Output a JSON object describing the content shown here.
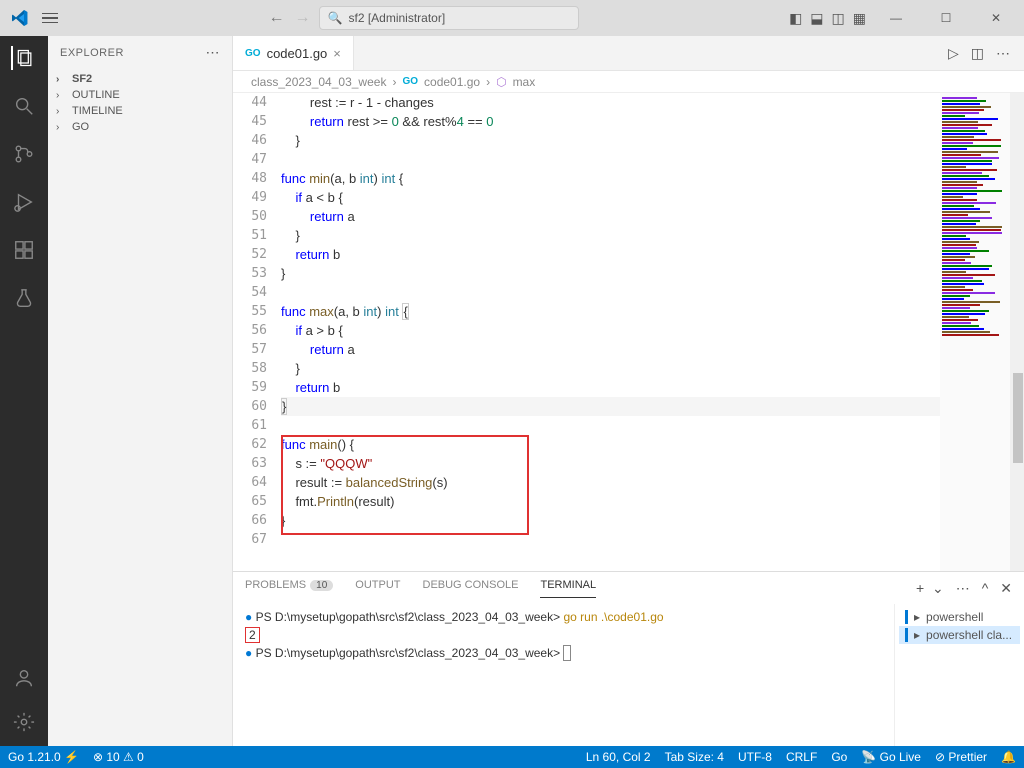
{
  "title_search": "sf2 [Administrator]",
  "explorer": {
    "title": "EXPLORER",
    "items": [
      "SF2",
      "OUTLINE",
      "TIMELINE",
      "GO"
    ]
  },
  "tab": {
    "filename": "code01.go",
    "close": "×"
  },
  "breadcrumb": {
    "folder": "class_2023_04_03_week",
    "file": "code01.go",
    "symbol": "max"
  },
  "code_lines": [
    {
      "n": "44",
      "html": "        rest := r - 1 - changes"
    },
    {
      "n": "45",
      "html": "        <span class='kw'>return</span> rest >= <span class='num'>0</span> && rest%<span class='num'>4</span> == <span class='num'>0</span>"
    },
    {
      "n": "46",
      "html": "    }"
    },
    {
      "n": "47",
      "html": ""
    },
    {
      "n": "48",
      "html": "<span class='kw'>func</span> <span class='fn'>min</span>(a, b <span class='typ'>int</span>) <span class='typ'>int</span> {"
    },
    {
      "n": "49",
      "html": "    <span class='kw'>if</span> a < b {"
    },
    {
      "n": "50",
      "html": "        <span class='kw'>return</span> a"
    },
    {
      "n": "51",
      "html": "    }"
    },
    {
      "n": "52",
      "html": "    <span class='kw'>return</span> b"
    },
    {
      "n": "53",
      "html": "}"
    },
    {
      "n": "54",
      "html": ""
    },
    {
      "n": "55",
      "html": "<span class='kw'>func</span> <span class='fn'>max</span>(a, b <span class='typ'>int</span>) <span class='typ'>int</span> <span style='border:1px solid #ccc'>{</span>"
    },
    {
      "n": "56",
      "html": "    <span class='kw'>if</span> a > b {"
    },
    {
      "n": "57",
      "html": "        <span class='kw'>return</span> a"
    },
    {
      "n": "58",
      "html": "    }"
    },
    {
      "n": "59",
      "html": "    <span class='kw'>return</span> b"
    },
    {
      "n": "60",
      "html": "<span class='hl-line'><span style='border:1px solid #ccc'>}</span></span>"
    },
    {
      "n": "61",
      "html": ""
    },
    {
      "n": "62",
      "html": "<span class='kw'>func</span> <span class='fn'>main</span>() {"
    },
    {
      "n": "63",
      "html": "    s := <span class='str'>\"QQQW\"</span>"
    },
    {
      "n": "64",
      "html": "    result := <span class='fn'>balancedString</span>(s)"
    },
    {
      "n": "65",
      "html": "    fmt.<span class='fn'>Println</span>(result)"
    },
    {
      "n": "66",
      "html": "}"
    },
    {
      "n": "67",
      "html": ""
    }
  ],
  "terminal": {
    "tabs": [
      "PROBLEMS",
      "OUTPUT",
      "DEBUG CONSOLE",
      "TERMINAL"
    ],
    "problems_count": "10",
    "line1_prompt": "PS D:\\mysetup\\gopath\\src\\sf2\\class_2023_04_03_week>",
    "line1_cmd": "go run .\\code01.go",
    "result": "2",
    "line2_prompt": "PS D:\\mysetup\\gopath\\src\\sf2\\class_2023_04_03_week>",
    "shells": [
      "powershell",
      "powershell cla..."
    ]
  },
  "status": {
    "go": "Go 1.21.0 ⚡",
    "errors": "⊗ 10 ⚠ 0",
    "ln": "Ln 60, Col 2",
    "tab": "Tab Size: 4",
    "enc": "UTF-8",
    "eol": "CRLF",
    "lang": "Go",
    "golive": "📡 Go Live",
    "prettier": "⊘ Prettier",
    "bell": "🔔"
  }
}
